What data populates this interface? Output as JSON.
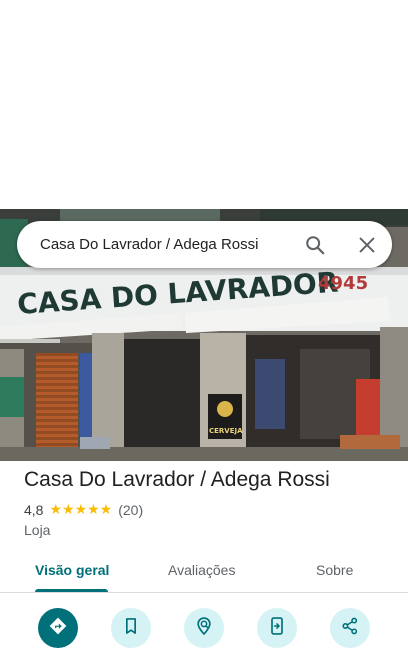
{
  "search": {
    "query": "Casa Do Lavrador / Adega Rossi"
  },
  "photo": {
    "sign_text": "CASA DO LAVRADOR",
    "sign_number": "4945",
    "poster_text": "CERVEJA"
  },
  "place": {
    "name": "Casa Do Lavrador / Adega Rossi",
    "rating": "4,8",
    "stars": "★★★★★",
    "review_count": "(20)",
    "category": "Loja"
  },
  "tabs": [
    {
      "label": "Visão geral",
      "active": true
    },
    {
      "label": "Avaliações",
      "active": false
    },
    {
      "label": "Sobre",
      "active": false
    }
  ],
  "actions": [
    "directions-icon",
    "save-icon",
    "nearby-icon",
    "send-to-phone-icon",
    "share-icon"
  ],
  "colors": {
    "accent": "#00707a",
    "action_bg": "#d5f2f4",
    "star": "#fbbc04"
  }
}
